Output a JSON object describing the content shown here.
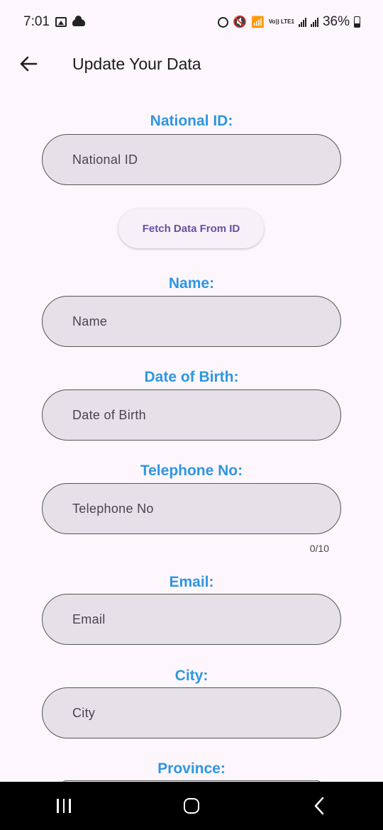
{
  "status_bar": {
    "time": "7:01",
    "network_label": "Vo)) LTE1",
    "battery_percent": "36%"
  },
  "app_bar": {
    "title": "Update Your Data",
    "back_icon": "arrow-left-icon"
  },
  "form": {
    "national_id": {
      "label": "National ID:",
      "placeholder": "National ID",
      "value": ""
    },
    "fetch_button": {
      "label": "Fetch Data From ID"
    },
    "name": {
      "label": "Name:",
      "placeholder": "Name",
      "value": ""
    },
    "date_of_birth": {
      "label": "Date of Birth:",
      "placeholder": "Date of Birth",
      "value": ""
    },
    "telephone": {
      "label": "Telephone No:",
      "placeholder": "Telephone No",
      "value": "",
      "counter": "0/10"
    },
    "email": {
      "label": "Email:",
      "placeholder": "Email",
      "value": ""
    },
    "city": {
      "label": "City:",
      "placeholder": "City",
      "value": ""
    },
    "province": {
      "label": "Province:"
    }
  },
  "colors": {
    "label_blue": "#2f96e0",
    "field_fill": "#e6e0e9",
    "button_text": "#6750a4",
    "background": "#fdf7fd"
  }
}
